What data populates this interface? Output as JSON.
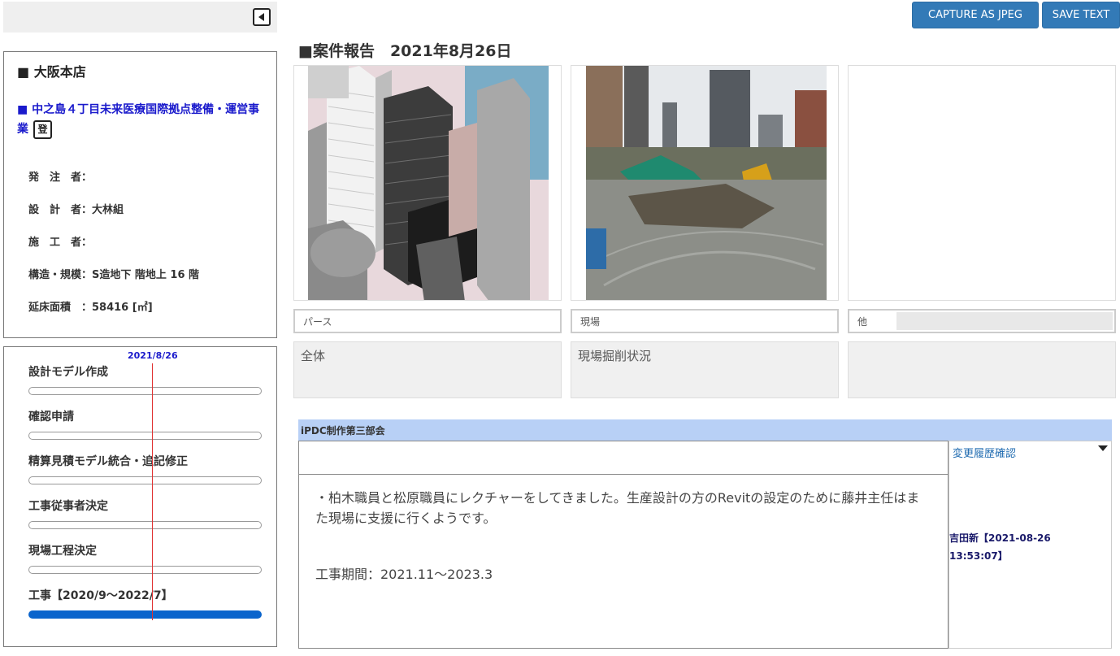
{
  "toolbar": {
    "capture_label": "CAPTURE AS JPEG",
    "save_label": "SAVE TEXT"
  },
  "report": {
    "title": "■案件報告　2021年8月26日"
  },
  "project": {
    "office": "■ 大阪本店",
    "name": "■ 中之島４丁目未来医療国際拠点整備・運営事業",
    "badge": "登",
    "rows": [
      "発　注　者：",
      "設　計　者：大林組",
      "施　工　者：",
      "構造・規模：S造地下 階地上 16 階",
      "延床面積　：58416 [㎡]"
    ]
  },
  "timeline": {
    "today_label": "2021/8/26",
    "items": [
      {
        "label": "設計モデル作成",
        "progress": 0
      },
      {
        "label": "確認申請",
        "progress": 0
      },
      {
        "label": "精算見積モデル統合・追記修正",
        "progress": 0
      },
      {
        "label": "工事従事者決定",
        "progress": 0
      },
      {
        "label": "現場工程決定",
        "progress": 0
      },
      {
        "label": "工事【2020/9～2022/7】",
        "progress": 1
      }
    ]
  },
  "photos": [
    {
      "caption": "パース",
      "description": "全体"
    },
    {
      "caption": "現場",
      "description": "現場掘削状況"
    },
    {
      "caption": "他",
      "description": ""
    }
  ],
  "comment": {
    "group": "iPDC制作第三部会",
    "body": "・柏木職員と松原職員にレクチャーをしてきました。生産設計の方のRevitの設定のために藤井主任はまた現場に支援に行くようです。",
    "period": "工事期間：2021.11～2023.3",
    "history_label": "変更履歴確認",
    "author": "吉田新【2021-08-26 13:53:07】"
  },
  "colors": {
    "accent_button": "#337ab7",
    "project_link": "#1a1acc",
    "panel_header": "#b8d0f6",
    "active_bar": "#0a64cc",
    "today_line": "#e03030"
  },
  "icons": {
    "collapse": "collapse-left-icon",
    "history_toggle": "chevron-down-icon"
  }
}
